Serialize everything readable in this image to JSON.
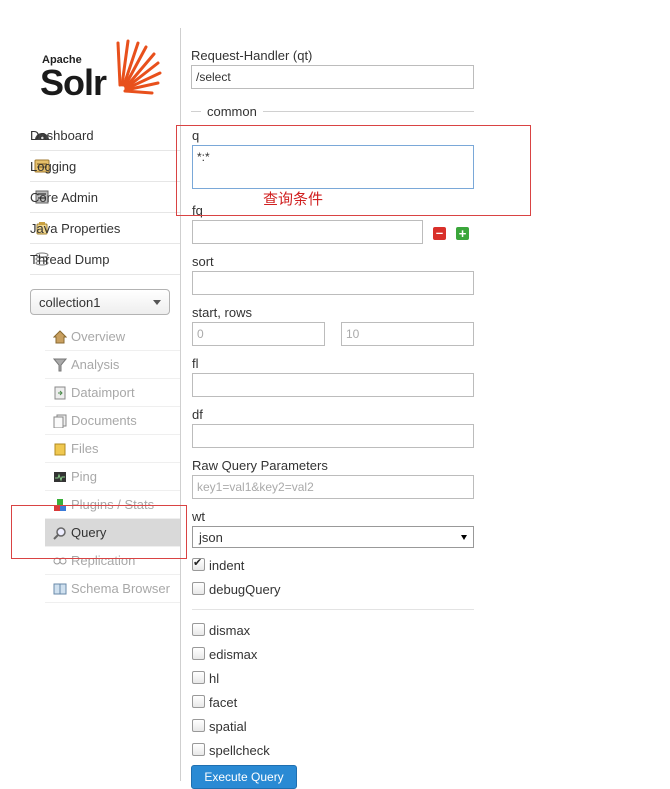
{
  "logo": {
    "apache": "Apache",
    "solr": "Solr"
  },
  "nav": {
    "items": [
      {
        "label": "Dashboard",
        "icon": "dashboard-icon"
      },
      {
        "label": "Logging",
        "icon": "logging-icon"
      },
      {
        "label": "Core Admin",
        "icon": "core-admin-icon"
      },
      {
        "label": "Java Properties",
        "icon": "java-icon"
      },
      {
        "label": "Thread Dump",
        "icon": "thread-icon"
      }
    ]
  },
  "collection": {
    "selected": "collection1"
  },
  "subnav": {
    "items": [
      {
        "label": "Overview"
      },
      {
        "label": "Analysis"
      },
      {
        "label": "Dataimport"
      },
      {
        "label": "Documents"
      },
      {
        "label": "Files"
      },
      {
        "label": "Ping"
      },
      {
        "label": "Plugins / Stats"
      },
      {
        "label": "Query"
      },
      {
        "label": "Replication"
      },
      {
        "label": "Schema Browser"
      }
    ]
  },
  "form": {
    "qt_label": "Request-Handler (qt)",
    "qt_value": "/select",
    "common_legend": "common",
    "q_label": "q",
    "q_value": "*:*",
    "fq_label": "fq",
    "sort_label": "sort",
    "start_rows_label": "start, rows",
    "start_placeholder": "0",
    "rows_placeholder": "10",
    "fl_label": "fl",
    "df_label": "df",
    "raw_label": "Raw Query Parameters",
    "raw_placeholder": "key1=val1&key2=val2",
    "wt_label": "wt",
    "wt_value": "json",
    "indent_label": "indent",
    "debug_label": "debugQuery",
    "dismax_label": "dismax",
    "edismax_label": "edismax",
    "hl_label": "hl",
    "facet_label": "facet",
    "spatial_label": "spatial",
    "spellcheck_label": "spellcheck",
    "execute_label": "Execute Query"
  },
  "annotation": {
    "text": "查询条件"
  },
  "colors": {
    "accent": "#2a8ad4",
    "annotation": "#d94343"
  }
}
